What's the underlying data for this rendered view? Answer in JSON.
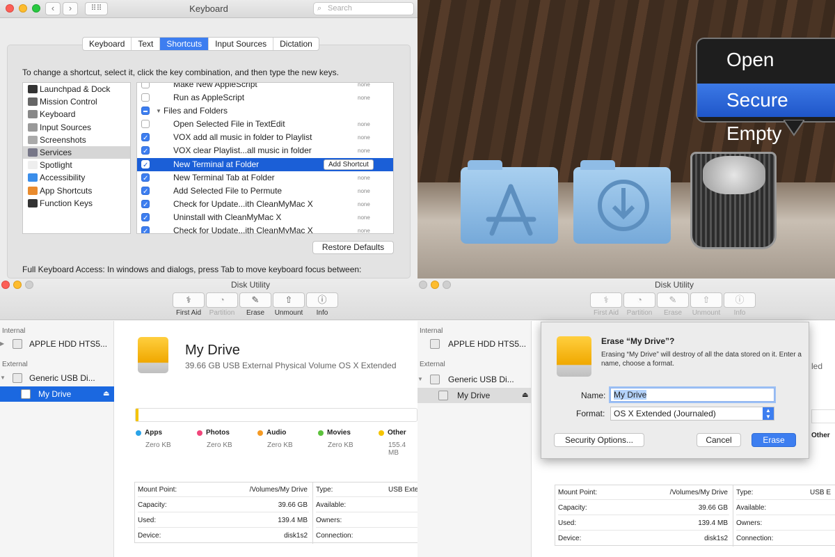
{
  "keyboard": {
    "title": "Keyboard",
    "search_placeholder": "Search",
    "tabs": [
      "Keyboard",
      "Text",
      "Shortcuts",
      "Input Sources",
      "Dictation"
    ],
    "active_tab": "Shortcuts",
    "instructions": "To change a shortcut, select it, click the key combination, and then type the new keys.",
    "categories": [
      "Launchpad & Dock",
      "Mission Control",
      "Keyboard",
      "Input Sources",
      "Screenshots",
      "Services",
      "Spotlight",
      "Accessibility",
      "App Shortcuts",
      "Function Keys"
    ],
    "selected_category": "Services",
    "shortcuts": [
      {
        "label": "Make New AppleScript",
        "checked": false,
        "shortcut": "none"
      },
      {
        "label": "Run as AppleScript",
        "checked": false,
        "shortcut": "none"
      },
      {
        "label": "Files and Folders",
        "group": true,
        "checked": "mixed",
        "shortcut": ""
      },
      {
        "label": "Open Selected File in TextEdit",
        "checked": false,
        "shortcut": "none"
      },
      {
        "label": "VOX add all music in folder to Playlist",
        "checked": true,
        "shortcut": "none"
      },
      {
        "label": "VOX clear Playlist...all music in folder",
        "checked": true,
        "shortcut": "none"
      },
      {
        "label": "New Terminal at Folder",
        "checked": true,
        "selected": true,
        "shortcut": ""
      },
      {
        "label": "New Terminal Tab at Folder",
        "checked": true,
        "shortcut": "none"
      },
      {
        "label": "Add Selected File to Permute",
        "checked": true,
        "shortcut": "none"
      },
      {
        "label": "Check for Update...ith CleanMyMac X",
        "checked": true,
        "shortcut": "none"
      },
      {
        "label": "Uninstall with CleanMyMac X",
        "checked": true,
        "shortcut": "none"
      },
      {
        "label": "Check for Update...ith CleanMyMac X",
        "checked": true,
        "shortcut": "none"
      }
    ],
    "add_shortcut_label": "Add Shortcut",
    "restore_defaults_label": "Restore Defaults",
    "full_keyboard_access": "Full Keyboard Access: In windows and dialogs, press Tab to move keyboard focus between:"
  },
  "dock": {
    "menu_items": [
      "Open",
      "Secure Empty"
    ],
    "highlighted_item": "Secure Empty"
  },
  "disk_utility_left": {
    "title": "Disk Utility",
    "toolbar": [
      {
        "label": "First Aid",
        "icon": "stethoscope-icon",
        "enabled": true
      },
      {
        "label": "Partition",
        "icon": "pie-icon",
        "enabled": false
      },
      {
        "label": "Erase",
        "icon": "erase-icon",
        "enabled": true
      },
      {
        "label": "Unmount",
        "icon": "unmount-icon",
        "enabled": true
      },
      {
        "label": "Info",
        "icon": "info-icon",
        "enabled": true
      }
    ],
    "sidebar": {
      "internal_label": "Internal",
      "internal_disk": "APPLE HDD HTS5...",
      "external_label": "External",
      "external_disk": "Generic USB Di...",
      "volume": "My Drive"
    },
    "drive_name": "My Drive",
    "drive_desc": "39.66 GB USB External Physical Volume OS X Extended",
    "usage_fill": 0.01,
    "legend": [
      {
        "label": "Apps",
        "size": "Zero KB",
        "color": "#2aa3e8"
      },
      {
        "label": "Photos",
        "size": "Zero KB",
        "color": "#f0457a"
      },
      {
        "label": "Audio",
        "size": "Zero KB",
        "color": "#f59a23"
      },
      {
        "label": "Movies",
        "size": "Zero KB",
        "color": "#5cc23c"
      },
      {
        "label": "Other",
        "size": "155.4 MB",
        "color": "#f5c400"
      }
    ],
    "info": {
      "mount_point_label": "Mount Point:",
      "mount_point": "/Volumes/My Drive",
      "capacity_label": "Capacity:",
      "capacity": "39.66 GB",
      "used_label": "Used:",
      "used": "139.4 MB",
      "device_label": "Device:",
      "device": "disk1s2",
      "type_label": "Type:",
      "type": "USB Exte",
      "available_label": "Available:",
      "owners_label": "Owners:",
      "connection_label": "Connection:"
    }
  },
  "disk_utility_right": {
    "title": "Disk Utility",
    "sidebar_volume": "My Drive",
    "sheet": {
      "title": "Erase “My Drive”?",
      "message": "Erasing “My Drive” will destroy of all the data stored on it. Enter a name, choose a format.",
      "name_label": "Name:",
      "name_value": "My Drive",
      "format_label": "Format:",
      "format_value": "OS X Extended (Journaled)",
      "security_options_label": "Security Options...",
      "cancel_label": "Cancel",
      "erase_label": "Erase"
    },
    "partial_right_text": "led",
    "other_label": "Other",
    "type_value": "USB E"
  }
}
